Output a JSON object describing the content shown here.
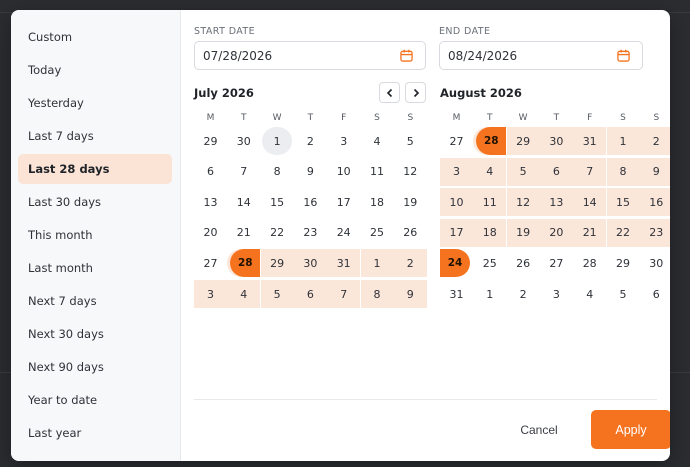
{
  "presets": [
    {
      "label": "Custom",
      "active": false
    },
    {
      "label": "Today",
      "active": false
    },
    {
      "label": "Yesterday",
      "active": false
    },
    {
      "label": "Last 7 days",
      "active": false
    },
    {
      "label": "Last 28 days",
      "active": true
    },
    {
      "label": "Last 30 days",
      "active": false
    },
    {
      "label": "This month",
      "active": false
    },
    {
      "label": "Last month",
      "active": false
    },
    {
      "label": "Next 7 days",
      "active": false
    },
    {
      "label": "Next 30 days",
      "active": false
    },
    {
      "label": "Next 90 days",
      "active": false
    },
    {
      "label": "Year to date",
      "active": false
    },
    {
      "label": "Last year",
      "active": false
    }
  ],
  "start": {
    "label": "START DATE",
    "value": "07/28/2026"
  },
  "end": {
    "label": "END DATE",
    "value": "08/24/2026"
  },
  "weekdays": [
    "M",
    "T",
    "W",
    "T",
    "F",
    "S",
    "S"
  ],
  "months": [
    {
      "title": "July 2026",
      "weeks": [
        [
          {
            "d": "29"
          },
          {
            "d": "30"
          },
          {
            "d": "1",
            "s": "today"
          },
          {
            "d": "2"
          },
          {
            "d": "3"
          },
          {
            "d": "4"
          },
          {
            "d": "5"
          }
        ],
        [
          {
            "d": "6"
          },
          {
            "d": "7"
          },
          {
            "d": "8"
          },
          {
            "d": "9"
          },
          {
            "d": "10"
          },
          {
            "d": "11"
          },
          {
            "d": "12"
          }
        ],
        [
          {
            "d": "13"
          },
          {
            "d": "14"
          },
          {
            "d": "15"
          },
          {
            "d": "16"
          },
          {
            "d": "17"
          },
          {
            "d": "18"
          },
          {
            "d": "19"
          }
        ],
        [
          {
            "d": "20"
          },
          {
            "d": "21"
          },
          {
            "d": "22"
          },
          {
            "d": "23"
          },
          {
            "d": "24"
          },
          {
            "d": "25"
          },
          {
            "d": "26"
          }
        ],
        [
          {
            "d": "27"
          },
          {
            "d": "28",
            "s": "start"
          },
          {
            "d": "29",
            "s": "range"
          },
          {
            "d": "30",
            "s": "range"
          },
          {
            "d": "31",
            "s": "range"
          },
          {
            "d": "1",
            "s": "range"
          },
          {
            "d": "2",
            "s": "range"
          }
        ],
        [
          {
            "d": "3",
            "s": "range"
          },
          {
            "d": "4",
            "s": "range"
          },
          {
            "d": "5",
            "s": "range"
          },
          {
            "d": "6",
            "s": "range"
          },
          {
            "d": "7",
            "s": "range"
          },
          {
            "d": "8",
            "s": "range"
          },
          {
            "d": "9",
            "s": "range"
          }
        ]
      ]
    },
    {
      "title": "August 2026",
      "weeks": [
        [
          {
            "d": "27"
          },
          {
            "d": "28",
            "s": "start"
          },
          {
            "d": "29",
            "s": "range"
          },
          {
            "d": "30",
            "s": "range"
          },
          {
            "d": "31",
            "s": "range"
          },
          {
            "d": "1",
            "s": "range"
          },
          {
            "d": "2",
            "s": "range"
          }
        ],
        [
          {
            "d": "3",
            "s": "range"
          },
          {
            "d": "4",
            "s": "range"
          },
          {
            "d": "5",
            "s": "range"
          },
          {
            "d": "6",
            "s": "range"
          },
          {
            "d": "7",
            "s": "range"
          },
          {
            "d": "8",
            "s": "range"
          },
          {
            "d": "9",
            "s": "range"
          }
        ],
        [
          {
            "d": "10",
            "s": "range"
          },
          {
            "d": "11",
            "s": "range"
          },
          {
            "d": "12",
            "s": "range"
          },
          {
            "d": "13",
            "s": "range"
          },
          {
            "d": "14",
            "s": "range"
          },
          {
            "d": "15",
            "s": "range"
          },
          {
            "d": "16",
            "s": "range"
          }
        ],
        [
          {
            "d": "17",
            "s": "range"
          },
          {
            "d": "18",
            "s": "range"
          },
          {
            "d": "19",
            "s": "range"
          },
          {
            "d": "20",
            "s": "range"
          },
          {
            "d": "21",
            "s": "range"
          },
          {
            "d": "22",
            "s": "range"
          },
          {
            "d": "23",
            "s": "range"
          }
        ],
        [
          {
            "d": "24",
            "s": "end"
          },
          {
            "d": "25"
          },
          {
            "d": "26"
          },
          {
            "d": "27"
          },
          {
            "d": "28"
          },
          {
            "d": "29"
          },
          {
            "d": "30"
          }
        ],
        [
          {
            "d": "31"
          },
          {
            "d": "1"
          },
          {
            "d": "2"
          },
          {
            "d": "3"
          },
          {
            "d": "4"
          },
          {
            "d": "5"
          },
          {
            "d": "6"
          }
        ]
      ]
    }
  ],
  "actions": {
    "cancel": "Cancel",
    "apply": "Apply"
  },
  "icons": {
    "calendar": "calendar-icon",
    "prev": "chevron-left-icon",
    "next": "chevron-right-icon"
  },
  "colors": {
    "accent": "#f5731f",
    "range": "#fbe6da",
    "active_preset": "#fbe4d6"
  }
}
